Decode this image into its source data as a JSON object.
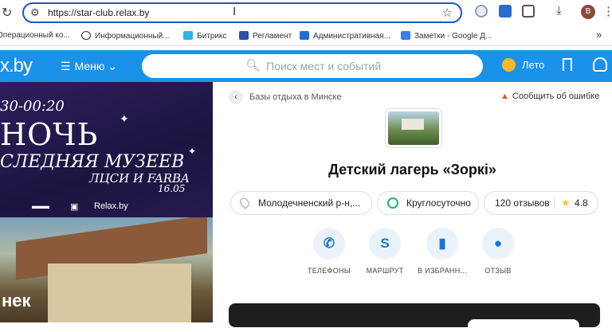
{
  "browser": {
    "url": "https://star-club.relax.by",
    "avatar_letter": "B"
  },
  "bookmarks": [
    {
      "label": "Операционный ко...",
      "color": "#ffffff"
    },
    {
      "label": "Информационный...",
      "color": "#ffffff"
    },
    {
      "label": "Битрикс",
      "color": "#2fb4e8"
    },
    {
      "label": "Регламент",
      "color": "#2d4fa8"
    },
    {
      "label": "Административная...",
      "color": "#1e6fd9"
    },
    {
      "label": "Заметки - Google Д...",
      "color": "#3b7ded"
    }
  ],
  "header": {
    "logo": "x.by",
    "menu_label": "Меню",
    "search_placeholder": "Поиск мест и событий",
    "season_label": "Лето"
  },
  "banner": {
    "time": "30-00:20",
    "big_text": "НОЧЬ",
    "line2": "СЛЕДНЯЯ МУЗЕЕВ",
    "line3": "ЛЦСИ И FARBA",
    "line4": "16.05",
    "partners": "Relax.by"
  },
  "photo": {
    "title": "нек"
  },
  "panel": {
    "breadcrumb": "Базы отдыха в Минске",
    "report": "Сообщить об ошибке",
    "title": "Детский лагерь «Зоркі»",
    "location": "Молодечненский р-н,...",
    "hours": "Круглосуточно",
    "reviews": "120 отзывов",
    "rating": "4.8",
    "actions": [
      {
        "label": "ТЕЛЕФОНЫ",
        "icon": "phone-icon"
      },
      {
        "label": "МАРШРУТ",
        "icon": "route-icon"
      },
      {
        "label": "В ИЗБРАНН...",
        "icon": "bookmark-icon"
      },
      {
        "label": "ОТЗЫВ",
        "icon": "chat-icon"
      }
    ]
  }
}
